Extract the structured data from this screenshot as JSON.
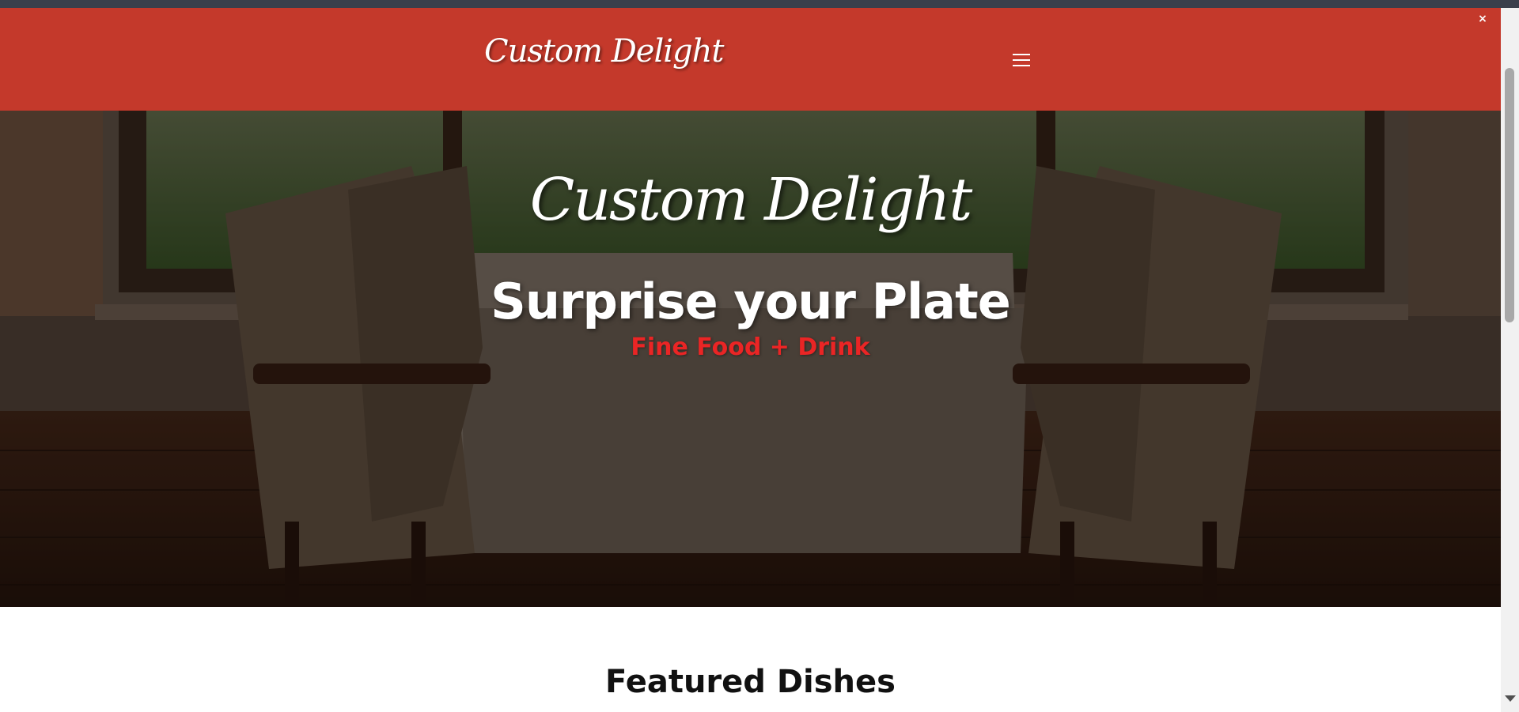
{
  "header": {
    "logo_text": "Custom Delight",
    "menu_icon": "hamburger-menu-icon",
    "close_label": "×",
    "brand_color": "#c4392b"
  },
  "hero": {
    "script_title": "Custom Delight",
    "headline": "Surprise your Plate",
    "tagline": "Fine Food + Drink",
    "tagline_color": "#ea2525",
    "background_image": "restaurant-dining-table-photo"
  },
  "featured": {
    "heading": "Featured Dishes"
  },
  "scrollbar": {
    "arrow_icon": "scroll-down-arrow-icon"
  }
}
